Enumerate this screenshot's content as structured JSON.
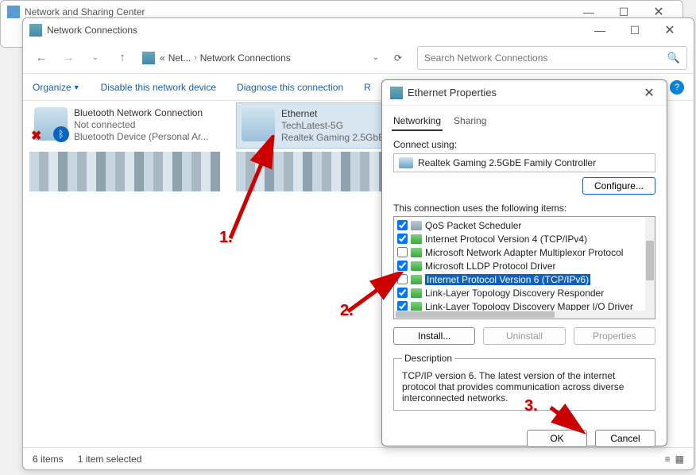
{
  "bg_window": {
    "title": "Network and Sharing Center"
  },
  "main_window": {
    "title": "Network Connections",
    "breadcrumb": {
      "net": "Net...",
      "current": "Network Connections"
    },
    "search_placeholder": "Search Network Connections",
    "toolbar": {
      "organize": "Organize",
      "disable": "Disable this network device",
      "diagnose": "Diagnose this connection",
      "rename_initial": "R"
    },
    "items": {
      "bluetooth": {
        "name": "Bluetooth Network Connection",
        "status": "Not connected",
        "device": "Bluetooth Device (Personal Ar..."
      },
      "ethernet": {
        "name": "Ethernet",
        "status": "TechLatest-5G",
        "device": "Realtek Gaming 2.5GbE"
      }
    },
    "status": {
      "count": "6 items",
      "selected": "1 item selected"
    }
  },
  "prop": {
    "title": "Ethernet Properties",
    "tabs": {
      "networking": "Networking",
      "sharing": "Sharing"
    },
    "connect_using": "Connect using:",
    "adapter": "Realtek Gaming 2.5GbE Family Controller",
    "configure": "Configure...",
    "uses_label": "This connection uses the following items:",
    "items": [
      {
        "checked": true,
        "label": "QoS Packet Scheduler",
        "grey": true
      },
      {
        "checked": true,
        "label": "Internet Protocol Version 4 (TCP/IPv4)"
      },
      {
        "checked": false,
        "label": "Microsoft Network Adapter Multiplexor Protocol"
      },
      {
        "checked": true,
        "label": "Microsoft LLDP Protocol Driver"
      },
      {
        "checked": false,
        "label": "Internet Protocol Version 6 (TCP/IPv6)",
        "selected": true
      },
      {
        "checked": true,
        "label": "Link-Layer Topology Discovery Responder"
      },
      {
        "checked": true,
        "label": "Link-Layer Topology Discovery Mapper I/O Driver"
      }
    ],
    "install": "Install...",
    "uninstall": "Uninstall",
    "properties": "Properties",
    "desc_label": "Description",
    "desc_text": "TCP/IP version 6. The latest version of the internet protocol that provides communication across diverse interconnected networks.",
    "ok": "OK",
    "cancel": "Cancel"
  },
  "annotations": {
    "n1": "1.",
    "n2": "2.",
    "n3": "3."
  }
}
